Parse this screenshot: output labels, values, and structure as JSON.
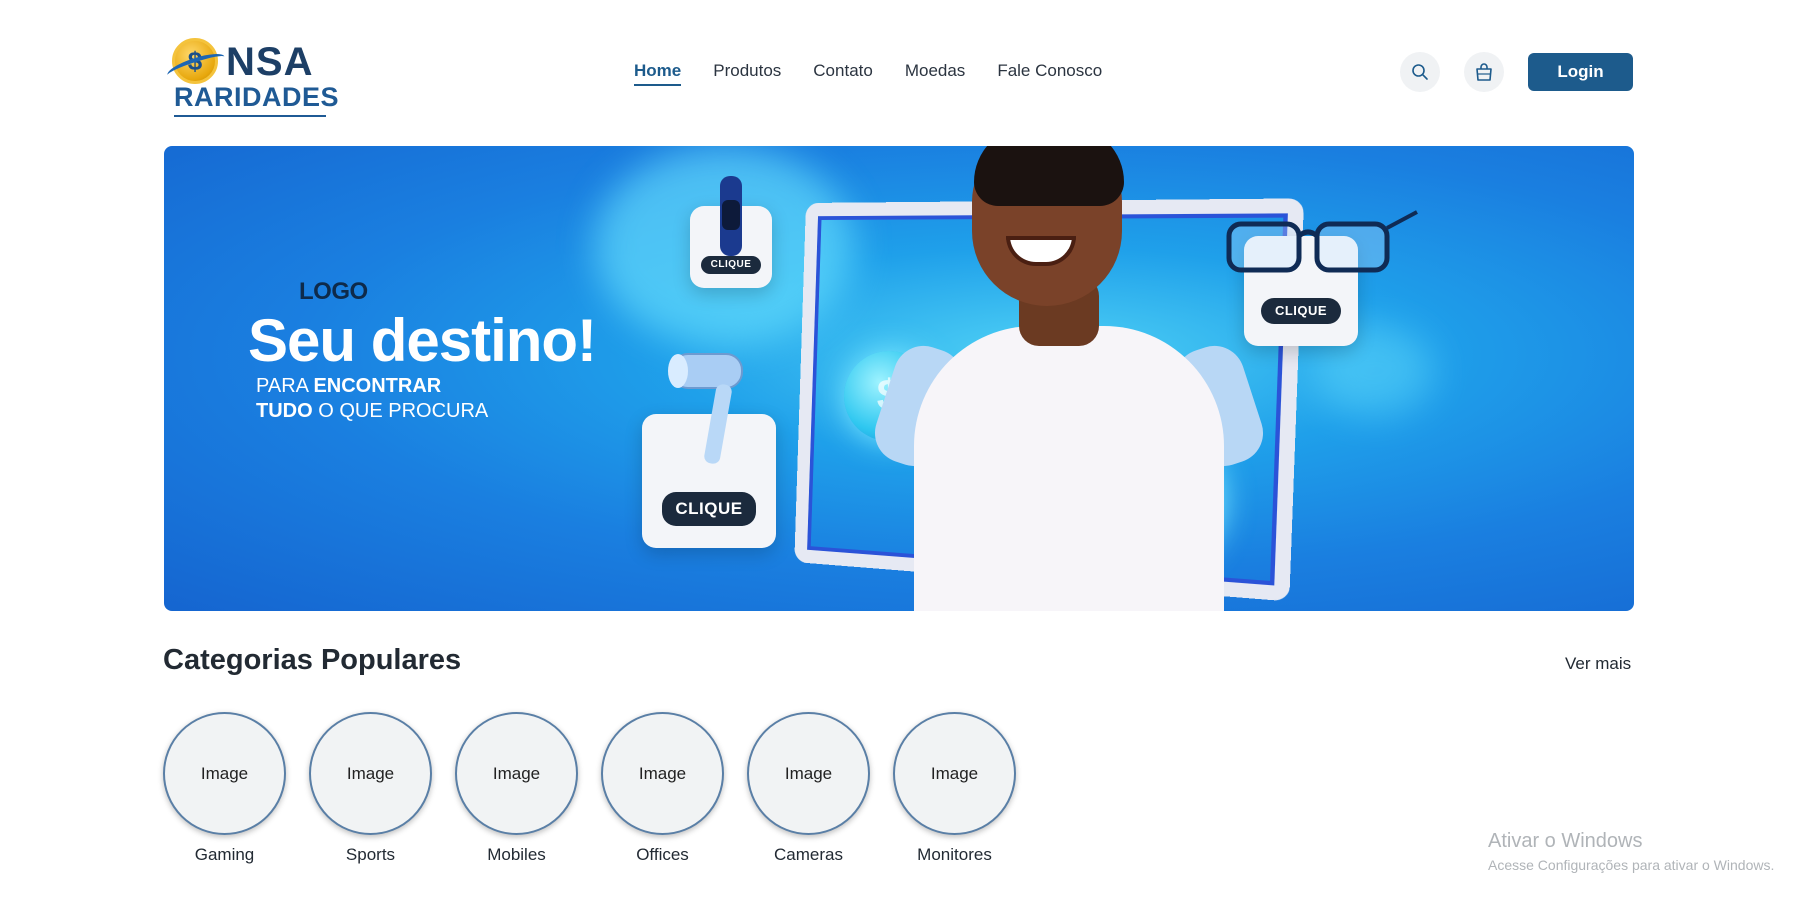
{
  "brand": {
    "name_top": "NSA",
    "name_bottom": "RARIDADES"
  },
  "nav": {
    "items": [
      {
        "label": "Home",
        "active": true
      },
      {
        "label": "Produtos",
        "active": false
      },
      {
        "label": "Contato",
        "active": false
      },
      {
        "label": "Moedas",
        "active": false
      },
      {
        "label": "Fale Conosco",
        "active": false
      }
    ]
  },
  "header_actions": {
    "search_icon": "search-icon",
    "bag_icon": "shopping-bag-icon",
    "login_label": "Login"
  },
  "banner": {
    "logo_text": "LOGO",
    "title": "Seu destino!",
    "subtitle_line1_pre": "PARA ",
    "subtitle_line1_bold": "ENCONTRAR",
    "subtitle_line2_bold": "TUDO",
    "subtitle_line2_post": " O QUE PROCURA",
    "cta_labels": [
      "CLIQUE",
      "CLIQUE",
      "CLIQUE"
    ]
  },
  "categories": {
    "title": "Categorias Populares",
    "see_more": "Ver mais",
    "items": [
      {
        "image": "Image",
        "label": "Gaming"
      },
      {
        "image": "Image",
        "label": "Sports"
      },
      {
        "image": "Image",
        "label": "Mobiles"
      },
      {
        "image": "Image",
        "label": "Offices"
      },
      {
        "image": "Image",
        "label": "Cameras"
      },
      {
        "image": "Image",
        "label": "Monitores"
      }
    ]
  },
  "os_watermark": {
    "line1": "Ativar o Windows",
    "line2": "Acesse Configurações para ativar o Windows."
  },
  "colors": {
    "primary": "#1d5b8c",
    "banner_blue": "#1a7fe0",
    "dark": "#222a33"
  }
}
